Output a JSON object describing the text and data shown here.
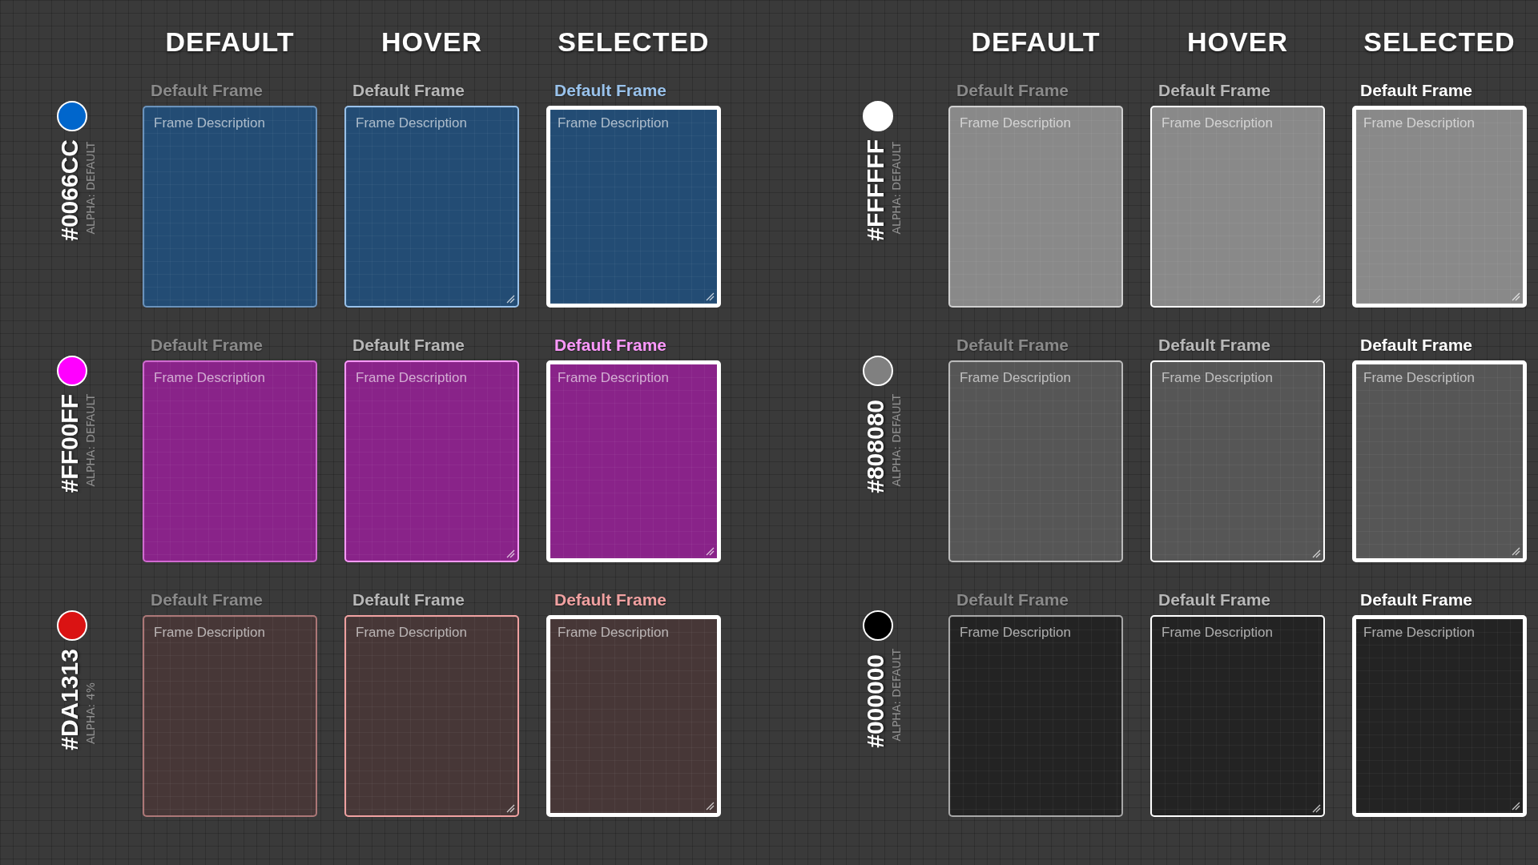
{
  "panels": [
    {
      "headers": [
        "DEFAULT",
        "HOVER",
        "SELECTED"
      ],
      "swatches": [
        {
          "hex": "#0066CC",
          "alpha": "ALPHA: DEFAULT",
          "color": "#0066cc",
          "kind": "solid",
          "frames": [
            {
              "title": "Default Frame",
              "description": "Frame Description",
              "kind": "default"
            },
            {
              "title": "Default Frame",
              "description": "Frame Description",
              "kind": "hover"
            },
            {
              "title": "Default Frame",
              "description": "Frame Description",
              "kind": "selected"
            }
          ]
        },
        {
          "hex": "#FF00FF",
          "alpha": "ALPHA: DEFAULT",
          "color": "#ff00ff",
          "kind": "solid",
          "frames": [
            {
              "title": "Default Frame",
              "description": "Frame Description",
              "kind": "default"
            },
            {
              "title": "Default Frame",
              "description": "Frame Description",
              "kind": "hover"
            },
            {
              "title": "Default Frame",
              "description": "Frame Description",
              "kind": "selected"
            }
          ]
        },
        {
          "hex": "#DA1313",
          "alpha": "ALPHA: 4%",
          "color": "#da1313",
          "kind": "faint",
          "frames": [
            {
              "title": "Default Frame",
              "description": "Frame Description",
              "kind": "default"
            },
            {
              "title": "Default Frame",
              "description": "Frame Description",
              "kind": "hover"
            },
            {
              "title": "Default Frame",
              "description": "Frame Description",
              "kind": "selected"
            }
          ]
        }
      ]
    },
    {
      "headers": [
        "DEFAULT",
        "HOVER",
        "SELECTED"
      ],
      "swatches": [
        {
          "hex": "#FFFFFF",
          "alpha": "ALPHA: DEFAULT",
          "color": "#ffffff",
          "kind": "solid",
          "frames": [
            {
              "title": "Default Frame",
              "description": "Frame Description",
              "kind": "default"
            },
            {
              "title": "Default Frame",
              "description": "Frame Description",
              "kind": "hover"
            },
            {
              "title": "Default Frame",
              "description": "Frame Description",
              "kind": "selected"
            }
          ]
        },
        {
          "hex": "#808080",
          "alpha": "ALPHA: DEFAULT",
          "color": "#808080",
          "kind": "solid",
          "frames": [
            {
              "title": "Default Frame",
              "description": "Frame Description",
              "kind": "default"
            },
            {
              "title": "Default Frame",
              "description": "Frame Description",
              "kind": "hover"
            },
            {
              "title": "Default Frame",
              "description": "Frame Description",
              "kind": "selected"
            }
          ]
        },
        {
          "hex": "#000000",
          "alpha": "ALPHA: DEFAULT",
          "color": "#000000",
          "kind": "solid",
          "frames": [
            {
              "title": "Default Frame",
              "description": "Frame Description",
              "kind": "default"
            },
            {
              "title": "Default Frame",
              "description": "Frame Description",
              "kind": "hover"
            },
            {
              "title": "Default Frame",
              "description": "Frame Description",
              "kind": "selected"
            }
          ]
        }
      ]
    }
  ]
}
